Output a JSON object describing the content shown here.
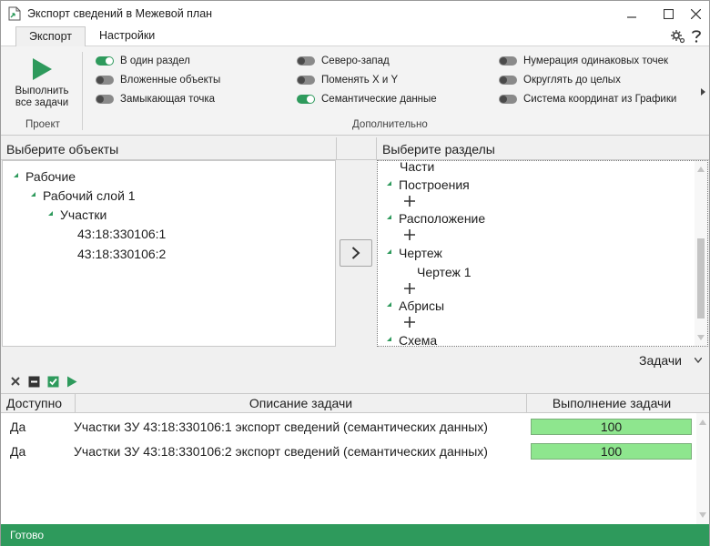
{
  "window": {
    "title": "Экспорт сведений в Межевой план",
    "icon": "document-export-icon"
  },
  "ribbon": {
    "tabs": [
      {
        "label": "Экспорт",
        "active": true
      },
      {
        "label": "Настройки",
        "active": false
      }
    ],
    "run_button": {
      "label_line1": "Выполнить",
      "label_line2": "все задачи"
    },
    "project_group_label": "Проект",
    "additional_group_label": "Дополнительно",
    "options": [
      {
        "label": "В один раздел",
        "on": true
      },
      {
        "label": "Вложенные объекты",
        "on": false
      },
      {
        "label": "Замыкающая точка",
        "on": false
      },
      {
        "label": "Северо-запад",
        "on": false
      },
      {
        "label": "Поменять X и Y",
        "on": false
      },
      {
        "label": "Семантические данные",
        "on": true
      },
      {
        "label": "Нумерация одинаковых точек",
        "on": false
      },
      {
        "label": "Округлять до целых",
        "on": false
      },
      {
        "label": "Система координат из Графики",
        "on": false
      }
    ]
  },
  "objects_panel": {
    "header": "Выберите объекты",
    "tree": [
      {
        "label": "Рабочие",
        "expanded": true
      },
      {
        "label": "Рабочий слой 1",
        "expanded": true
      },
      {
        "label": "Участки",
        "expanded": true
      },
      {
        "label": "43:18:330106:1"
      },
      {
        "label": "43:18:330106:2"
      }
    ]
  },
  "sections_panel": {
    "header": "Выберите разделы",
    "items": [
      {
        "label": "Части"
      },
      {
        "label": "Построения"
      },
      {
        "label": "Расположение"
      },
      {
        "label": "Чертеж"
      },
      {
        "label": "Чертеж 1"
      },
      {
        "label": "Абрисы"
      },
      {
        "label": "Схема"
      }
    ]
  },
  "tasks": {
    "title": "Задачи",
    "columns": [
      "Доступно",
      "Описание задачи",
      "Выполнение задачи"
    ],
    "rows": [
      {
        "available": "Да",
        "description": "Участки ЗУ 43:18:330106:1 экспорт сведений (семантических данных)",
        "progress": "100"
      },
      {
        "available": "Да",
        "description": "Участки ЗУ 43:18:330106:2 экспорт сведений (семантических данных)",
        "progress": "100"
      }
    ]
  },
  "status": {
    "text": "Готово"
  },
  "colors": {
    "accent": "#2e9a5c",
    "progress_fill": "#8ee68e"
  }
}
